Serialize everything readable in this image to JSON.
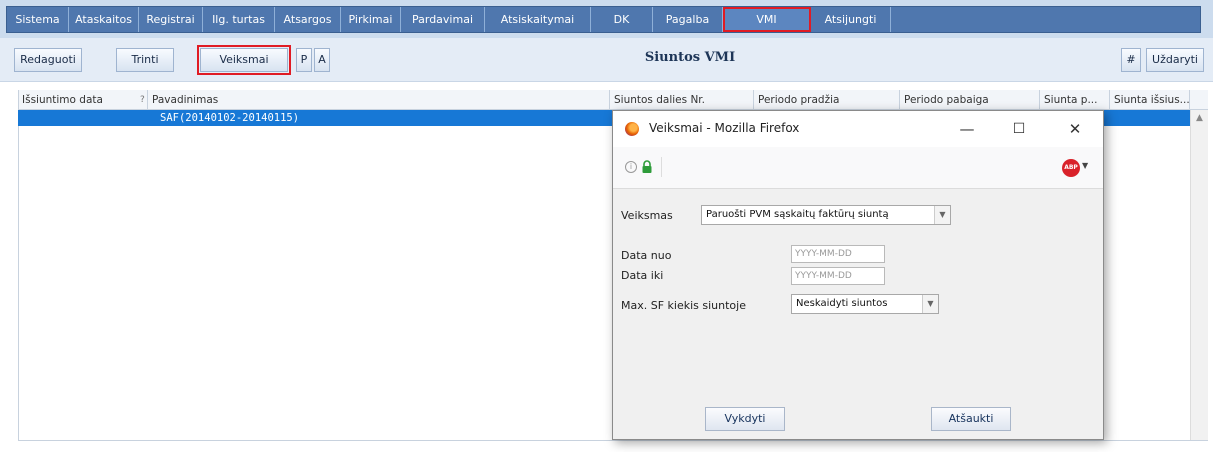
{
  "menu": {
    "items": [
      "Sistema",
      "Ataskaitos",
      "Registrai",
      "Ilg. turtas",
      "Atsargos",
      "Pirkimai",
      "Pardavimai",
      "Atsiskaitymai",
      "DK",
      "Pagalba",
      "VMI",
      "Atsijungti"
    ],
    "active": "VMI"
  },
  "toolbar": {
    "edit_label": "Redaguoti",
    "delete_label": "Trinti",
    "actions_label": "Veiksmai",
    "p_label": "P",
    "a_label": "A",
    "title": "Siuntos VMI",
    "hash_label": "#",
    "close_label": "Uždaryti"
  },
  "grid": {
    "columns": [
      "Išsiuntimo data",
      "Pavadinimas",
      "Siuntos dalies Nr.",
      "Periodo pradžia",
      "Periodo pabaiga",
      "Siunta p...",
      "Siunta išsius..."
    ],
    "sort_indicator": "?",
    "rows": [
      {
        "name": "SAF(20140102-20140115)"
      }
    ]
  },
  "dialog": {
    "title": "Veiksmai - Mozilla Firefox",
    "actions_label": "Veiksmas",
    "actions_value": "Paruošti PVM sąskaitų faktūrų siuntą",
    "date_from_label": "Data nuo",
    "date_from_placeholder": "YYYY-MM-DD",
    "date_to_label": "Data iki",
    "date_to_placeholder": "YYYY-MM-DD",
    "max_sf_label": "Max. SF kiekis siuntoje",
    "max_sf_value": "Neskaidyti siuntos",
    "execute_label": "Vykdyti",
    "cancel_label": "Atšaukti",
    "minimize_glyph": "—",
    "maximize_glyph": "☐",
    "close_glyph": "✕",
    "abp_text": "ABP"
  },
  "colors": {
    "menu_bg": "#4f77ae",
    "selection": "#1778d6",
    "highlight_outline": "#e01b24"
  }
}
